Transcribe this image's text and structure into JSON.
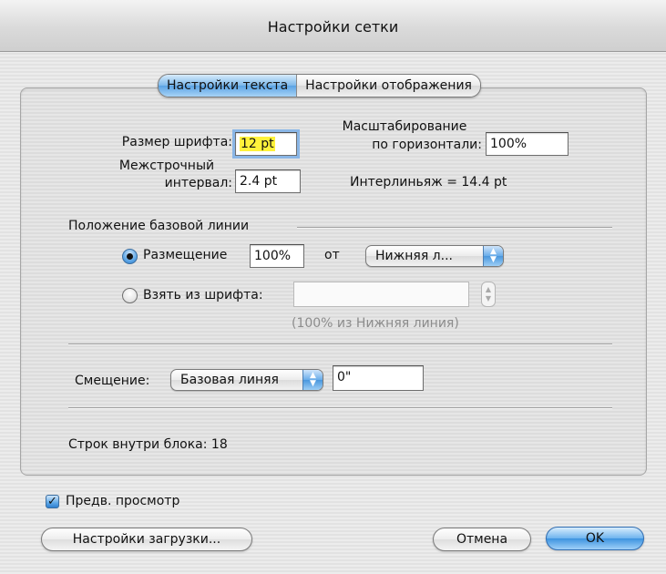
{
  "window": {
    "title": "Настройки сетки"
  },
  "tabs": [
    {
      "label": "Настройки текста",
      "selected": true
    },
    {
      "label": "Настройки отображения",
      "selected": false
    }
  ],
  "text_settings": {
    "font_size_label": "Размер шрифта:",
    "font_size_value": "12 pt",
    "horizontal_scale_label_line1": "Масштабирование",
    "horizontal_scale_label_line2": "по горизонтали:",
    "horizontal_scale_value": "100%",
    "line_spacing_label_line1": "Межстрочный",
    "line_spacing_label_line2": "интервал:",
    "line_spacing_value": "2.4 pt",
    "leading_text": "Интерлиньяж =  14.4 pt"
  },
  "baseline": {
    "section_title": "Положение базовой линии",
    "placement_label": "Размещение",
    "placement_selected": true,
    "placement_value": "100%",
    "from_label": "от",
    "from_popup_value": "Нижняя л...",
    "from_font_label": "Взять из шрифта:",
    "from_font_selected": false,
    "from_font_value": "",
    "hint": "(100% из Нижняя линия)"
  },
  "offset": {
    "label": "Смещение:",
    "popup_value": "Базовая линяя",
    "value": "0\""
  },
  "lines_in_block": {
    "text": "Строк внутри блока: 18"
  },
  "preview": {
    "label": "Предв. просмотр",
    "checked": true
  },
  "buttons": {
    "load_settings": "Настройки загрузки...",
    "cancel": "Отмена",
    "ok": "OK"
  },
  "colors": {
    "accent": "#5aa3e4",
    "highlight": "#fff23b"
  }
}
